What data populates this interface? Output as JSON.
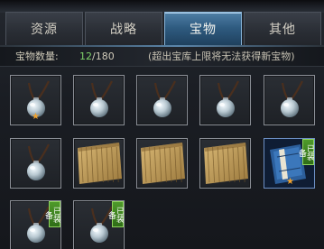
{
  "tabs": [
    {
      "label": "资源",
      "active": false
    },
    {
      "label": "战略",
      "active": false
    },
    {
      "label": "宝物",
      "active": true
    },
    {
      "label": "其他",
      "active": false
    }
  ],
  "treasure_count": {
    "label": "宝物数量:",
    "current": "12",
    "separator": "/",
    "max": "180",
    "hint": "(超出宝库上限将无法获得新宝物)"
  },
  "colors": {
    "active_tab": "#2f5b80",
    "count_current": "#7fd36a",
    "equipped_badge": "#3f8a22"
  },
  "items": [
    {
      "icon": "pearl-pendant-icon",
      "equipped": false,
      "star": true
    },
    {
      "icon": "pearl-pendant-icon",
      "equipped": false,
      "star": false
    },
    {
      "icon": "pearl-pendant-icon",
      "equipped": false,
      "star": false
    },
    {
      "icon": "pearl-pendant-icon",
      "equipped": false,
      "star": false
    },
    {
      "icon": "pearl-pendant-icon",
      "equipped": false,
      "star": false
    },
    {
      "icon": "pearl-pendant-icon",
      "equipped": false,
      "star": false
    },
    {
      "icon": "bamboo-scroll-icon",
      "equipped": false,
      "star": false
    },
    {
      "icon": "bamboo-scroll-icon",
      "equipped": false,
      "star": false
    },
    {
      "icon": "bamboo-scroll-icon",
      "equipped": false,
      "star": false
    },
    {
      "icon": "blue-book-icon",
      "equipped": true,
      "star": true
    },
    {
      "icon": "pearl-pendant-icon",
      "equipped": true,
      "star": false
    },
    {
      "icon": "pearl-pendant-icon",
      "equipped": true,
      "star": false
    }
  ],
  "equipped_label": "已装备",
  "star_glyph": "★"
}
